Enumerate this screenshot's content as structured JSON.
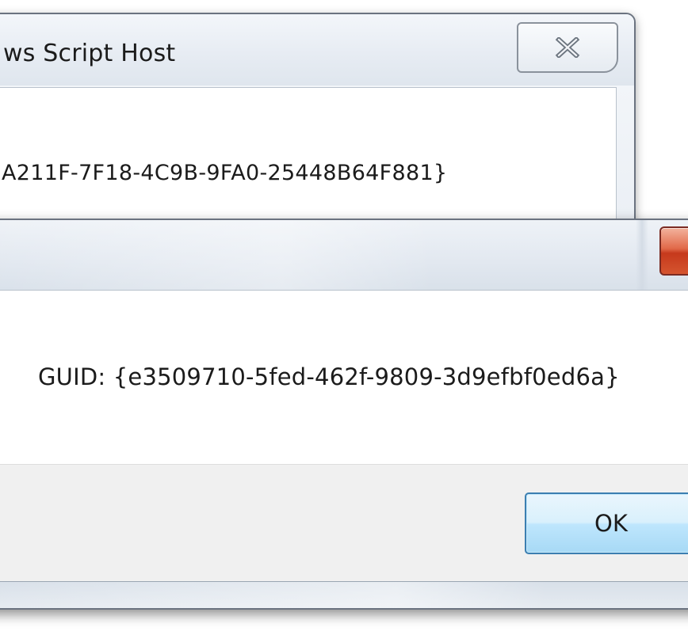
{
  "back_dialog": {
    "title": "ws Script Host",
    "message": "A211F-7F18-4C9B-9FA0-25448B64F881}",
    "close_icon": "close-x-icon"
  },
  "front_dialog": {
    "title": "",
    "message": "GUID: {e3509710-5fed-462f-9809-3d9efbf0ed6a}",
    "ok_label": "OK",
    "close_icon": "close-x-icon"
  },
  "colors": {
    "ok_border": "#3c7fb1",
    "close_red": "#c6391c",
    "footer_bg": "#f0f0f0"
  }
}
